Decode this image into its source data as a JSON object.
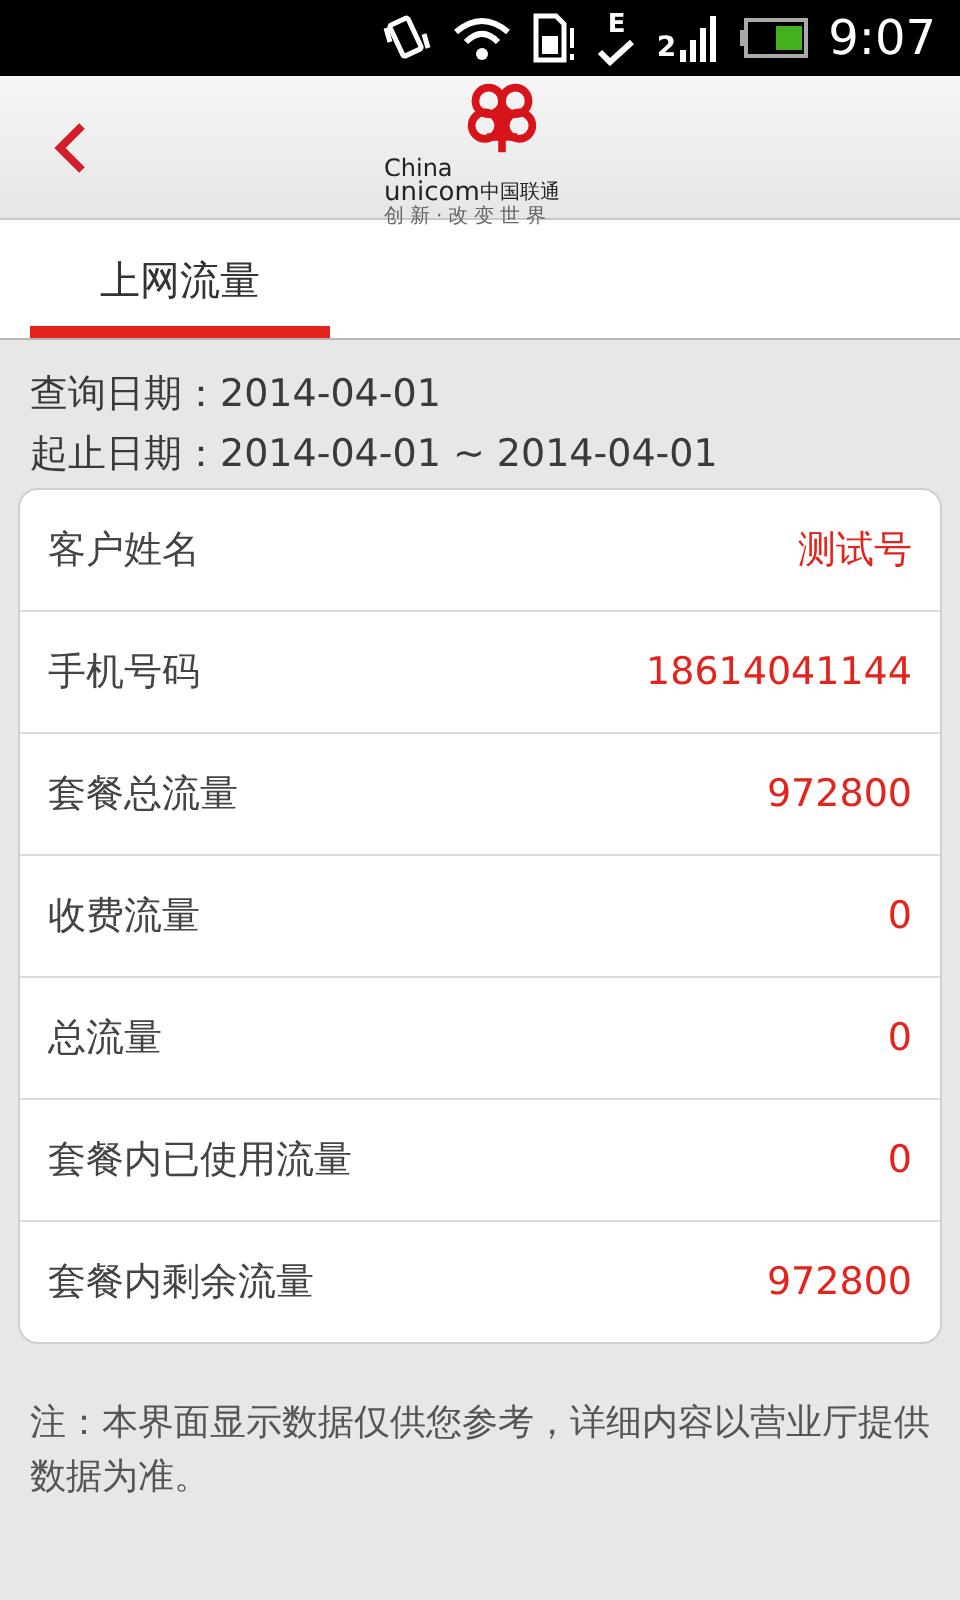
{
  "status_bar": {
    "network_type": "E",
    "sim_slot": "2",
    "time": "9:07"
  },
  "header": {
    "logo": {
      "line_1": "China",
      "line_2_latin": "unicom",
      "line_2_cjk": "中国联通",
      "slogan": "创新·改变世界"
    }
  },
  "tabs": [
    {
      "label": "上网流量",
      "selected": true
    }
  ],
  "query": {
    "query_date": "查询日期：2014-04-01",
    "date_range": "起止日期：2014-04-01 ~ 2014-04-01"
  },
  "details": [
    {
      "label": "客户姓名",
      "value": "测试号"
    },
    {
      "label": "手机号码",
      "value": "18614041144"
    },
    {
      "label": "套餐总流量",
      "value": "972800"
    },
    {
      "label": "收费流量",
      "value": "0"
    },
    {
      "label": "总流量",
      "value": "0"
    },
    {
      "label": "套餐内已使用流量",
      "value": "0"
    },
    {
      "label": "套餐内剩余流量",
      "value": "972800"
    }
  ],
  "note": "注：本界面显示数据仅供您参考，详细内容以营业厅提供数据为准。"
}
